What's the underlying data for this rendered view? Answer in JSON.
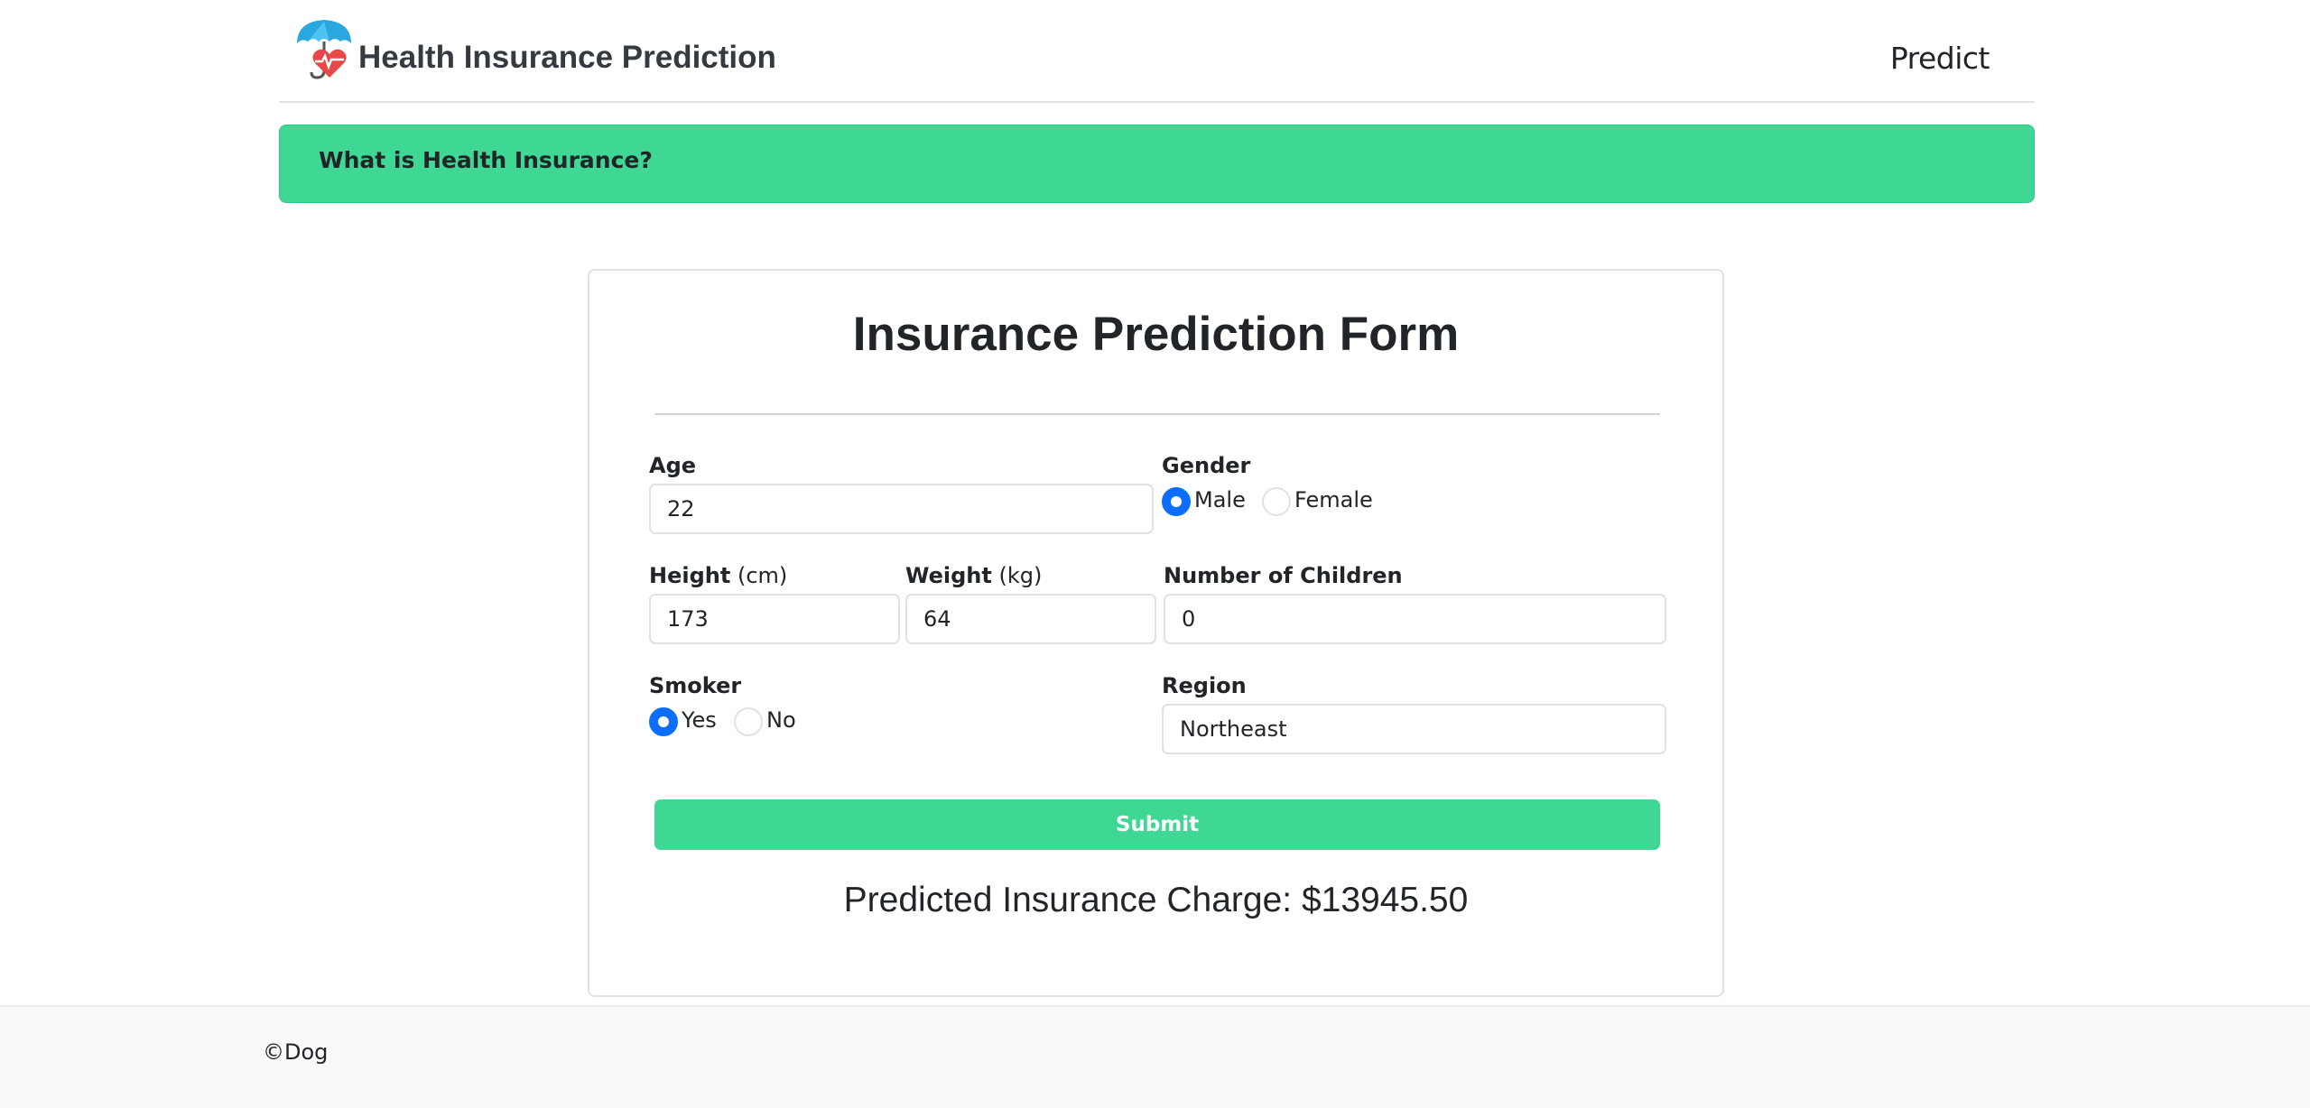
{
  "header": {
    "brand_title": "Health Insurance Prediction",
    "nav_predict": "Predict"
  },
  "alert": {
    "text": "What is Health Insurance?"
  },
  "form": {
    "title": "Insurance Prediction Form",
    "age": {
      "label": "Age",
      "value": "22"
    },
    "gender": {
      "label": "Gender",
      "options": [
        "Male",
        "Female"
      ],
      "selected": "Male"
    },
    "height": {
      "label": "Height",
      "unit": "(cm)",
      "value": "173"
    },
    "weight": {
      "label": "Weight",
      "unit": "(kg)",
      "value": "64"
    },
    "children": {
      "label": "Number of Children",
      "value": "0"
    },
    "smoker": {
      "label": "Smoker",
      "options": [
        "Yes",
        "No"
      ],
      "selected": "Yes"
    },
    "region": {
      "label": "Region",
      "value": "Northeast"
    },
    "submit_label": "Submit",
    "result": "Predicted Insurance Charge: $13945.50"
  },
  "footer": {
    "text": "©Dog"
  },
  "colors": {
    "accent_green": "#3fd794",
    "radio_blue": "#0d6efd"
  }
}
